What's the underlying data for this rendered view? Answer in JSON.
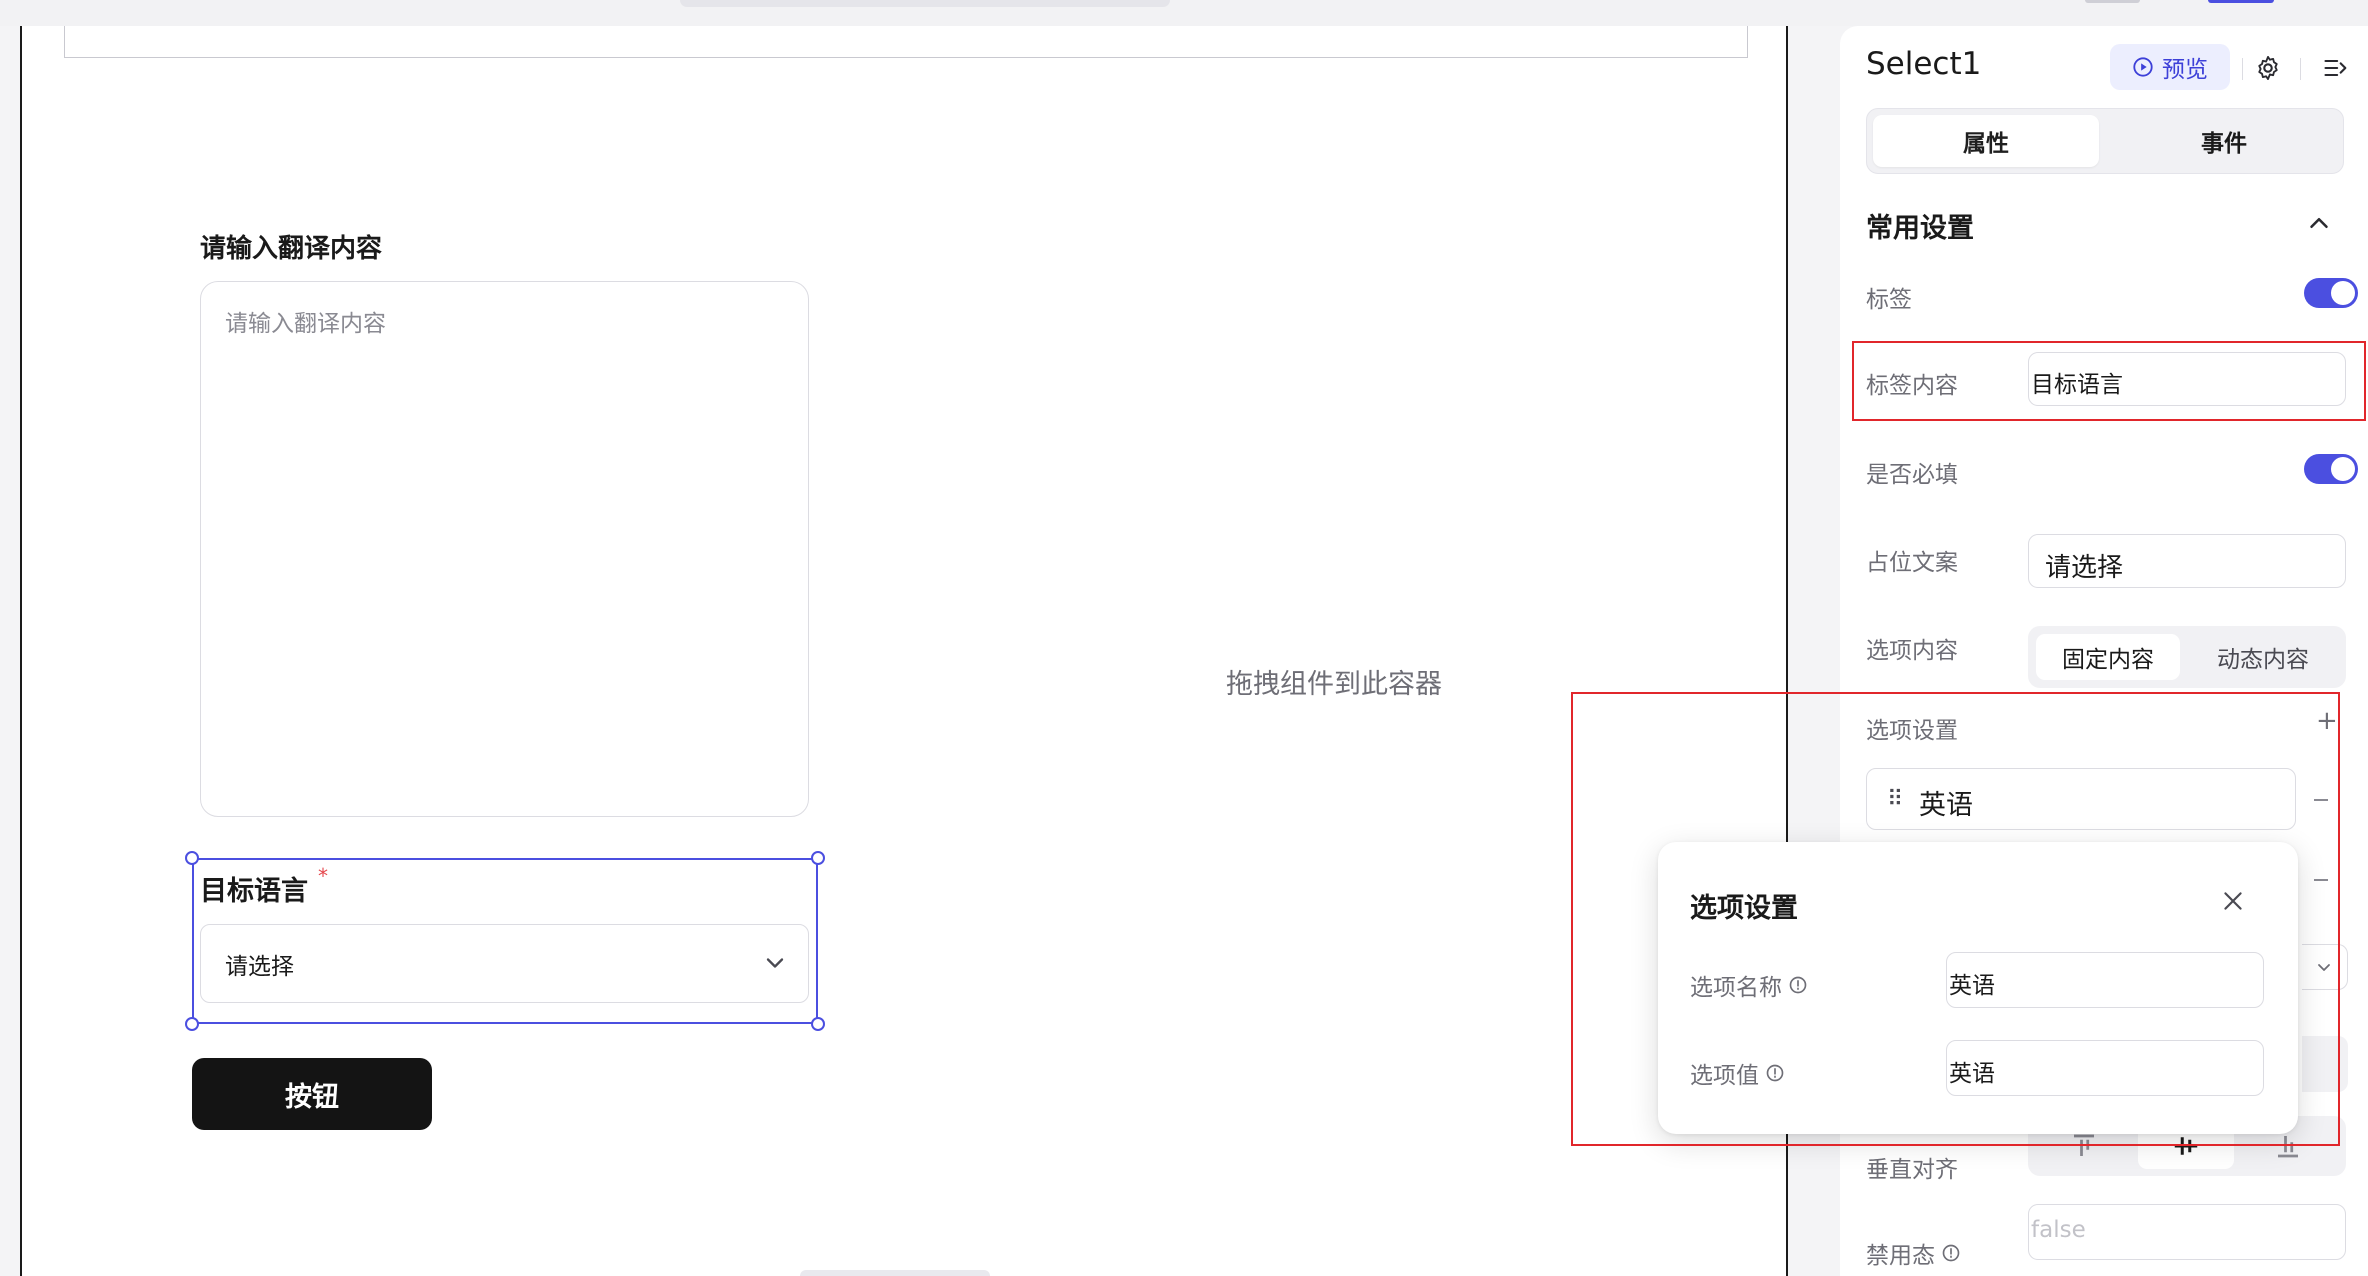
{
  "canvas": {
    "textarea_label": "请输入翻译内容",
    "textarea_placeholder": "请输入翻译内容",
    "drop_hint": "拖拽组件到此容器",
    "select_label": "目标语言",
    "required_mark": "*",
    "select_placeholder": "请选择",
    "button_label": "按钮"
  },
  "panel": {
    "title": "Select1",
    "preview_label": "预览",
    "tabs": [
      {
        "label": "属性",
        "active": true
      },
      {
        "label": "事件",
        "active": false
      }
    ],
    "section_title": "常用设置",
    "rows": {
      "label_toggle": {
        "label": "标签",
        "on": true
      },
      "label_content": {
        "label": "标签内容",
        "value": "目标语言"
      },
      "required": {
        "label": "是否必填",
        "on": true
      },
      "placeholder": {
        "label": "占位文案",
        "value": "请选择"
      },
      "options_content": {
        "label": "选项内容",
        "options": [
          "固定内容",
          "动态内容"
        ],
        "selected": "固定内容"
      },
      "options_setting": {
        "label": "选项设置",
        "add": "+"
      },
      "option_item": {
        "text": "英语"
      },
      "vertical_align": {
        "label": "垂直对齐"
      },
      "disabled": {
        "label": "禁用态",
        "value": "false"
      }
    }
  },
  "popover": {
    "title": "选项设置",
    "name_label": "选项名称",
    "name_value": "英语",
    "value_label": "选项值",
    "value_value": "英语"
  },
  "colors": {
    "accent": "#4b4fe0",
    "highlight": "#e1262b",
    "button": "#141414"
  }
}
